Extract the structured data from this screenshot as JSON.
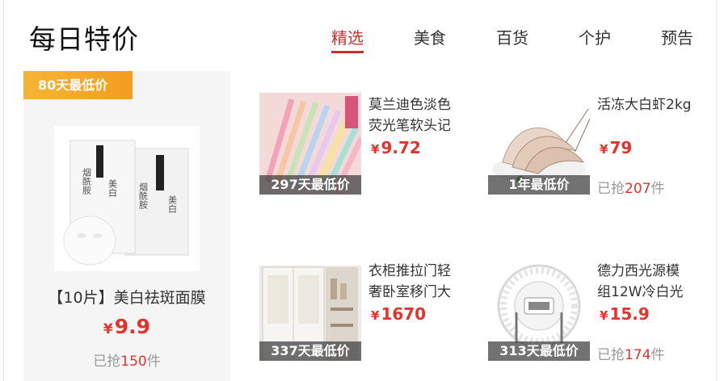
{
  "header": {
    "title": "每日特价"
  },
  "tabs": [
    {
      "label": "精选",
      "active": true
    },
    {
      "label": "美食"
    },
    {
      "label": "百货"
    },
    {
      "label": "个护"
    },
    {
      "label": "预告"
    }
  ],
  "featured": {
    "badge": "80天最低价",
    "name": "【10片】美白祛斑面膜",
    "currency": "¥",
    "price": "9.9",
    "grab_prefix": "已抢",
    "grab_count": "150",
    "grab_suffix": "件"
  },
  "items": [
    {
      "name": "莫兰迪色淡色荧光笔软头记",
      "currency": "¥",
      "price": "9.72",
      "label": "297天最低价",
      "grab_prefix": "",
      "grab_count": "",
      "grab_suffix": ""
    },
    {
      "name": "活冻大白虾2kg",
      "currency": "¥",
      "price": "79",
      "label": "1年最低价",
      "grab_prefix": "已抢",
      "grab_count": "207",
      "grab_suffix": "件"
    },
    {
      "name": "衣柜推拉门轻奢卧室移门大",
      "currency": "¥",
      "price": "1670",
      "label": "337天最低价",
      "grab_prefix": "",
      "grab_count": "",
      "grab_suffix": ""
    },
    {
      "name": "德力西光源模组12W冷白光",
      "currency": "¥",
      "price": "15.9",
      "label": "313天最低价",
      "grab_prefix": "已抢",
      "grab_count": "174",
      "grab_suffix": "件"
    }
  ],
  "colors": {
    "accent": "#c9302c",
    "price": "#e5322d",
    "badge": "#f5a623"
  },
  "icons": {
    "featured": "face-mask-product-image",
    "item0": "highlighter-pens-image",
    "item1": "shrimp-image",
    "item2": "wardrobe-image",
    "item3": "light-module-image"
  }
}
